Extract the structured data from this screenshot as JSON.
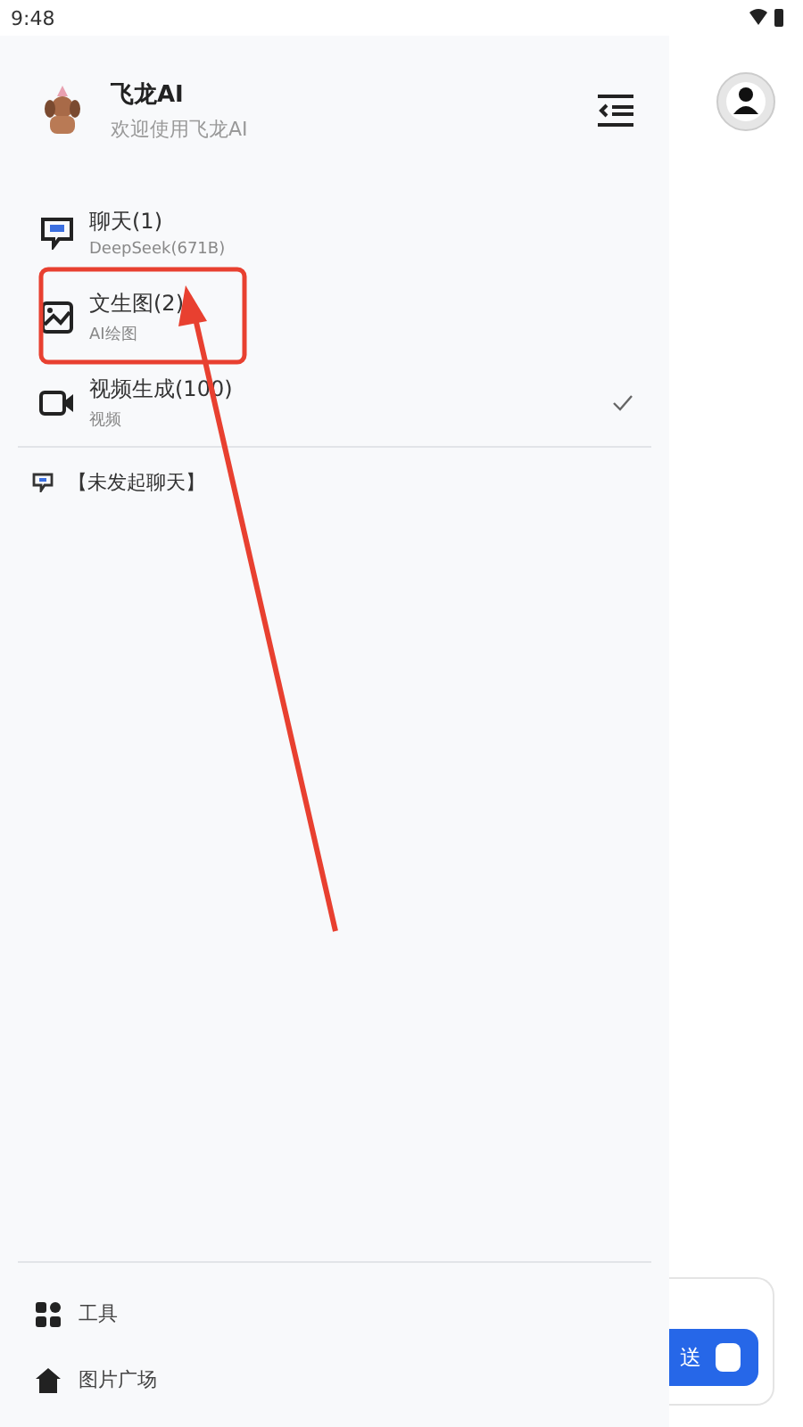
{
  "status_bar": {
    "time": "9:48"
  },
  "drawer": {
    "title": "飞龙AI",
    "subtitle": "欢迎使用飞龙AI",
    "modes": [
      {
        "kind": "chat",
        "label": "聊天(1)",
        "sublabel": "DeepSeek(671B)",
        "selected": false
      },
      {
        "kind": "image",
        "label": "文生图(2)",
        "sublabel": "AI绘图",
        "selected": false
      },
      {
        "kind": "video",
        "label": "视频生成(100)",
        "sublabel": "视频",
        "selected": true
      }
    ],
    "conversations": [
      {
        "label": "【未发起聊天】"
      }
    ],
    "footer_items": [
      {
        "kind": "tools",
        "label": "工具"
      },
      {
        "kind": "home",
        "label": "图片广场"
      }
    ]
  },
  "composer": {
    "send_label": "送"
  }
}
